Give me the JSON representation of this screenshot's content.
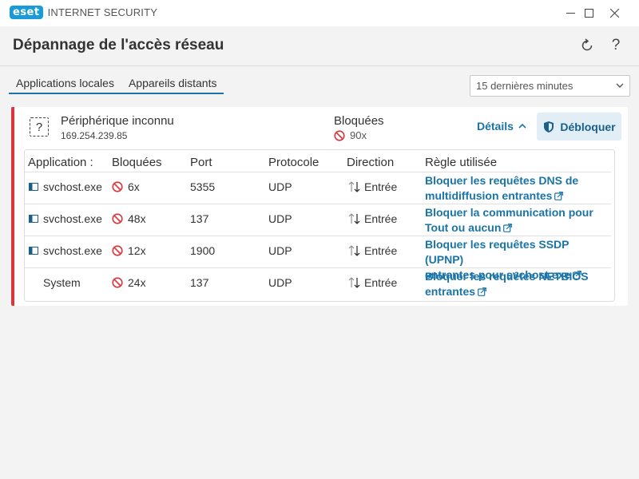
{
  "window": {
    "logo": "eset",
    "product": "INTERNET SECURITY",
    "icons": {
      "minimize": "minimize-icon",
      "maximize": "maximize-icon",
      "close": "close-icon"
    }
  },
  "header": {
    "title": "Dépannage de l'accès réseau",
    "refresh_icon": "refresh-icon",
    "help_icon": "?"
  },
  "tabs": [
    {
      "label": "Applications locales",
      "active": true
    },
    {
      "label": "Appareils distants",
      "active": false
    }
  ],
  "timerange": {
    "selected": "15 dernières minutes"
  },
  "device": {
    "icon": "?",
    "name": "Périphérique inconnu",
    "ip": "169.254.239.85",
    "blocked_label": "Bloquées",
    "blocked_count": "90x",
    "details_label": "Détails",
    "unblock_label": "Débloquer"
  },
  "table": {
    "headers": {
      "app": "Application :",
      "blocked": "Bloquées",
      "port": "Port",
      "protocol": "Protocole",
      "direction": "Direction",
      "rule": "Règle utilisée"
    },
    "rows": [
      {
        "app": "svchost.exe",
        "blocked": "6x",
        "port": "5355",
        "protocol": "UDP",
        "direction": "Entrée",
        "rule_line1": "Bloquer les requêtes DNS de",
        "rule_line2": "multidiffusion entrantes"
      },
      {
        "app": "svchost.exe",
        "blocked": "48x",
        "port": "137",
        "protocol": "UDP",
        "direction": "Entrée",
        "rule_line1": "Bloquer la communication pour",
        "rule_line2": "Tout ou aucun"
      },
      {
        "app": "svchost.exe",
        "blocked": "12x",
        "port": "1900",
        "protocol": "UDP",
        "direction": "Entrée",
        "rule_line1": "Bloquer les requêtes SSDP (UPNP)",
        "rule_line2": "entrantes pour svchost.exe"
      },
      {
        "app": "System",
        "blocked": "24x",
        "port": "137",
        "protocol": "UDP",
        "direction": "Entrée",
        "rule_line1": "Bloquer les requêtes NETBIOS",
        "rule_line2": "entrantes"
      }
    ]
  },
  "colors": {
    "accent": "#1a74a8",
    "brand": "#1a9bd7",
    "alert": "#d9363e"
  }
}
